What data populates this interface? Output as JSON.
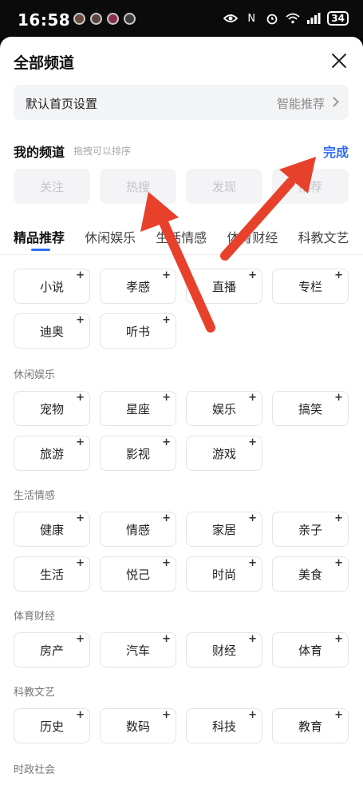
{
  "status_bar": {
    "time": "16:58",
    "battery": "34",
    "nfc": "N"
  },
  "header": {
    "title": "全部频道"
  },
  "default_home": {
    "label": "默认首页设置",
    "value": "智能推荐"
  },
  "my_channels": {
    "title": "我的频道",
    "hint": "拖拽可以排序",
    "done_label": "完成",
    "chips": [
      "关注",
      "热搜",
      "发现",
      "推荐"
    ]
  },
  "tabs": [
    "精品推荐",
    "休闲娱乐",
    "生活情感",
    "体育财经",
    "科教文艺"
  ],
  "categories": [
    {
      "title": "",
      "items": [
        "小说",
        "孝感",
        "直播",
        "专栏",
        "迪奥",
        "听书"
      ]
    },
    {
      "title": "休闲娱乐",
      "items": [
        "宠物",
        "星座",
        "娱乐",
        "搞笑",
        "旅游",
        "影视",
        "游戏"
      ]
    },
    {
      "title": "生活情感",
      "items": [
        "健康",
        "情感",
        "家居",
        "亲子",
        "生活",
        "悦己",
        "时尚",
        "美食"
      ]
    },
    {
      "title": "体育财经",
      "items": [
        "房产",
        "汽车",
        "财经",
        "体育"
      ]
    },
    {
      "title": "科教文艺",
      "items": [
        "历史",
        "数码",
        "科技",
        "教育"
      ]
    },
    {
      "title": "时政社会",
      "items": []
    }
  ],
  "plus_symbol": "+",
  "colors": {
    "accent": "#2f6cf5",
    "annotation_arrow": "#e8412b"
  }
}
